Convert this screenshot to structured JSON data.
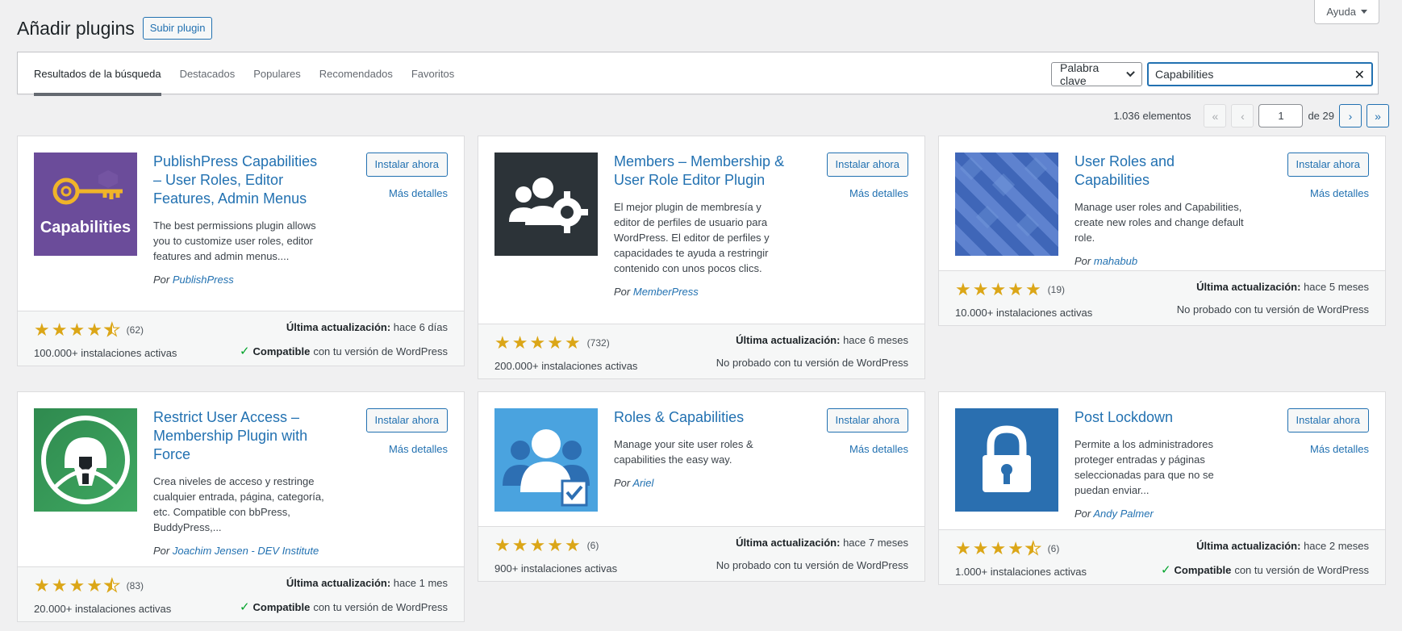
{
  "help": {
    "label": "Ayuda"
  },
  "header": {
    "title": "Añadir plugins",
    "upload_label": "Subir plugin"
  },
  "tabs": [
    {
      "label": "Resultados de la búsqueda",
      "current": true
    },
    {
      "label": "Destacados"
    },
    {
      "label": "Populares"
    },
    {
      "label": "Recomendados"
    },
    {
      "label": "Favoritos"
    }
  ],
  "search": {
    "type_selected": "Palabra clave",
    "value": "Capabilities"
  },
  "pagination": {
    "count": "1.036 elementos",
    "first": "«",
    "prev": "‹",
    "page": "1",
    "of": "de 29",
    "next": "›",
    "last": "»"
  },
  "cards": [
    {
      "name": "PublishPress Capabilities – User Roles, Editor Features, Admin Menus",
      "install": "Instalar ahora",
      "details": "Más detalles",
      "desc": "The best permissions plugin allows you to customize user roles, editor features and admin menus....",
      "by": "Por",
      "author": "PublishPress",
      "rating": 4.5,
      "rating_count": "(62)",
      "installs": "100.000+ instalaciones activas",
      "updated_label": "Última actualización:",
      "updated": "hace 6 días",
      "compat_bold": "Compatible",
      "compat_rest": "con tu versión de WordPress",
      "compatible": true,
      "icon": "key-icon",
      "icon_text": "Capabilities"
    },
    {
      "name": "Members – Membership & User Role Editor Plugin",
      "install": "Instalar ahora",
      "details": "Más detalles",
      "desc": "El mejor plugin de membresía y editor de perfiles de usuario para WordPress. El editor de perfiles y capacidades te ayuda a restringir contenido con unos pocos clics.",
      "by": "Por",
      "author": "MemberPress",
      "rating": 5,
      "rating_count": "(732)",
      "installs": "200.000+ instalaciones activas",
      "updated_label": "Última actualización:",
      "updated": "hace 6 meses",
      "compat_text": "No probado con tu versión de WordPress",
      "compatible": false,
      "icon": "users-gear-icon"
    },
    {
      "name": "User Roles and Capabilities",
      "install": "Instalar ahora",
      "details": "Más detalles",
      "desc": "Manage user roles and Capabilities, create new roles and change default role.",
      "by": "Por",
      "author": "mahabub",
      "rating": 5,
      "rating_count": "(19)",
      "installs": "10.000+ instalaciones activas",
      "updated_label": "Última actualización:",
      "updated": "hace 5 meses",
      "compat_text": "No probado con tu versión de WordPress",
      "compatible": false,
      "icon": "blue-pattern-icon"
    },
    {
      "name": "Restrict User Access – Membership Plugin with Force",
      "install": "Instalar ahora",
      "details": "Más detalles",
      "desc": "Crea niveles de acceso y restringe cualquier entrada, página, categoría, etc. Compatible con bbPress, BuddyPress,...",
      "by": "Por",
      "author": "Joachim Jensen - DEV Institute",
      "rating": 4.5,
      "rating_count": "(83)",
      "installs": "20.000+ instalaciones activas",
      "updated_label": "Última actualización:",
      "updated": "hace 1 mes",
      "compat_bold": "Compatible",
      "compat_rest": "con tu versión de WordPress",
      "compatible": true,
      "icon": "helmet-icon"
    },
    {
      "name": "Roles & Capabilities",
      "install": "Instalar ahora",
      "details": "Más detalles",
      "desc": "Manage your site user roles & capabilities the easy way.",
      "by": "Por",
      "author": "Ariel",
      "rating": 5,
      "rating_count": "(6)",
      "installs": "900+ instalaciones activas",
      "updated_label": "Última actualización:",
      "updated": "hace 7 meses",
      "compat_text": "No probado con tu versión de WordPress",
      "compatible": false,
      "icon": "user-check-icon"
    },
    {
      "name": "Post Lockdown",
      "install": "Instalar ahora",
      "details": "Más detalles",
      "desc": "Permite a los administradores proteger entradas y páginas seleccionadas para que no se puedan enviar...",
      "by": "Por",
      "author": "Andy Palmer",
      "rating": 4.5,
      "rating_count": "(6)",
      "installs": "1.000+ instalaciones activas",
      "updated_label": "Última actualización:",
      "updated": "hace 2 meses",
      "compat_bold": "Compatible",
      "compat_rest": "con tu versión de WordPress",
      "compatible": true,
      "icon": "padlock-icon"
    }
  ]
}
